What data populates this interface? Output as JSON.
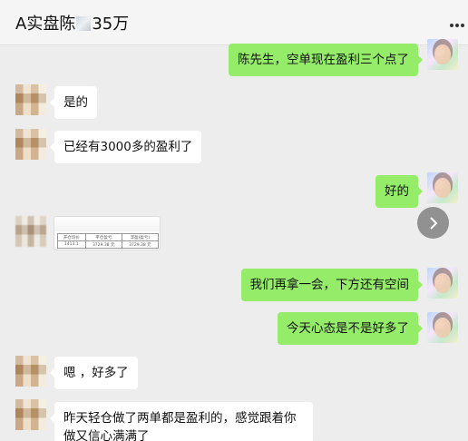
{
  "header": {
    "title_start": "A实盘陈",
    "title_end": "35万",
    "more_label": "more"
  },
  "messages": [
    {
      "id": "m1",
      "side": "out",
      "text": "陈先生，空单现在盈利三个点了"
    },
    {
      "id": "m2",
      "side": "in",
      "text": "是的"
    },
    {
      "id": "m3",
      "side": "in",
      "text": "已经有3000多的盈利了"
    },
    {
      "id": "m4",
      "side": "out",
      "text": "好的"
    },
    {
      "id": "m5",
      "side": "in",
      "type": "image",
      "table": {
        "headers": [
          "开仓均价",
          "平仓盈亏",
          "浮盈(盈亏)"
        ],
        "row": [
          "1413.1",
          "3729.38 元",
          "3729.38 元"
        ]
      }
    },
    {
      "id": "m6",
      "side": "out",
      "text": "我们再拿一会，下方还有空间"
    },
    {
      "id": "m7",
      "side": "out",
      "text": "今天心态是不是好多了"
    },
    {
      "id": "m8",
      "side": "in",
      "text": "嗯 ，好多了"
    },
    {
      "id": "m9",
      "side": "in",
      "text": "昨天轻仓做了两单都是盈利的，感觉跟着你做又信心满满了"
    }
  ],
  "colors": {
    "background": "#ededed",
    "outgoing_bubble": "#95ec69",
    "incoming_bubble": "#ffffff"
  },
  "icons": [
    "more-icon",
    "chevron-right-icon"
  ]
}
